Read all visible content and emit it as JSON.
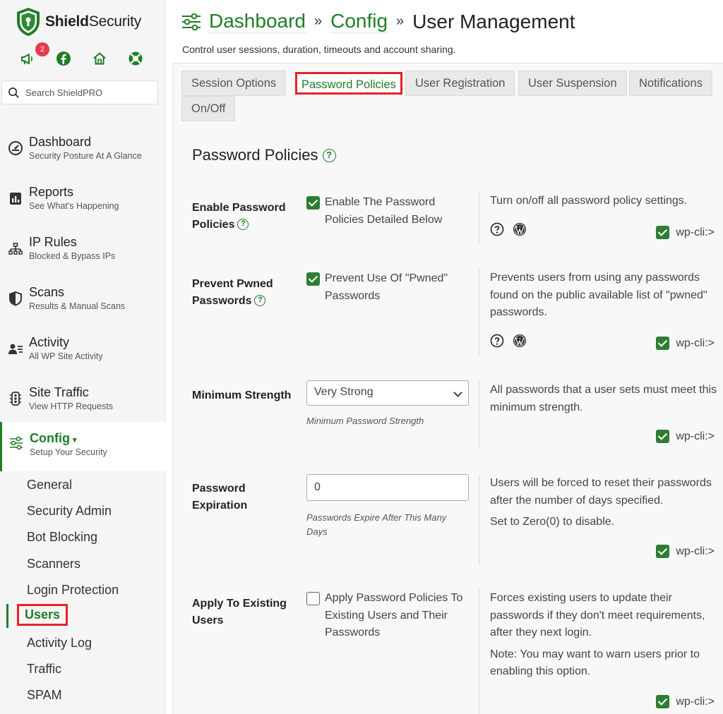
{
  "brand": {
    "name_bold": "Shield",
    "name_rest": "Security",
    "brand_color": "#1e7e25",
    "accent_red": "#e8212b"
  },
  "quick_icons": [
    {
      "icon": "megaphone-icon",
      "badge": "2"
    },
    {
      "icon": "facebook-icon"
    },
    {
      "icon": "home-icon"
    },
    {
      "icon": "lifebuoy-icon"
    }
  ],
  "search": {
    "placeholder": "Search ShieldPRO"
  },
  "nav": [
    {
      "icon": "gauge-icon",
      "title": "Dashboard",
      "sub": "Security Posture At A Glance"
    },
    {
      "icon": "reports-icon",
      "title": "Reports",
      "sub": "See What's Happening"
    },
    {
      "icon": "network-icon",
      "title": "IP Rules",
      "sub": "Blocked & Bypass IPs"
    },
    {
      "icon": "shield-half-icon",
      "title": "Scans",
      "sub": "Results & Manual Scans"
    },
    {
      "icon": "user-activity-icon",
      "title": "Activity",
      "sub": "All WP Site Activity"
    },
    {
      "icon": "traffic-icon",
      "title": "Site Traffic",
      "sub": "View HTTP Requests"
    },
    {
      "icon": "sliders-icon",
      "title": "Config",
      "caret": "▾",
      "sub": "Setup Your Security",
      "active": true
    }
  ],
  "config_subnav": [
    "General",
    "Security Admin",
    "Bot Blocking",
    "Scanners",
    "Login Protection",
    "Users",
    "Activity Log",
    "Traffic",
    "SPAM"
  ],
  "config_subnav_active": "Users",
  "breadcrumb": {
    "items": [
      "Dashboard",
      "Config"
    ],
    "separator": "»",
    "current": "User Management"
  },
  "page_description": "Control user sessions, duration, timeouts and account sharing.",
  "tabs": [
    {
      "label": "Session Options"
    },
    {
      "label": "Password Policies",
      "active": true
    },
    {
      "label": "User Registration"
    },
    {
      "label": "User Suspension"
    },
    {
      "label": "Notifications"
    },
    {
      "label": "On/Off"
    }
  ],
  "section_title": "Password Policies",
  "help_glyph": "?",
  "wpcli_label": "wp-cli:>",
  "options": [
    {
      "label": "Enable Password Policies",
      "control": "checkbox",
      "checked": true,
      "control_text": "Enable The Password Policies Detailed Below",
      "description": "Turn on/off all password policy settings.",
      "icons": [
        "help-circle-icon",
        "wordpress-icon"
      ],
      "wpcli_checked": true
    },
    {
      "label": "Prevent Pwned Passwords",
      "control": "checkbox",
      "checked": true,
      "control_text": "Prevent Use Of \"Pwned\" Passwords",
      "description": "Prevents users from using any passwords found on the public available list of \"pwned\" passwords.",
      "icons": [
        "help-circle-icon",
        "wordpress-icon"
      ],
      "wpcli_checked": true
    },
    {
      "label": "Minimum Strength",
      "control": "select",
      "value": "Very Strong",
      "helper": "Minimum Password Strength",
      "description": "All passwords that a user sets must meet this minimum strength.",
      "wpcli_checked": true
    },
    {
      "label": "Password Expiration",
      "control": "text",
      "value": "0",
      "helper": "Passwords Expire After This Many Days",
      "description": "Users will be forced to reset their passwords after the number of days specified.",
      "note": "Set to Zero(0) to disable.",
      "wpcli_checked": true
    },
    {
      "label": "Apply To Existing Users",
      "control": "checkbox",
      "checked": false,
      "control_text": "Apply Password Policies To Existing Users and Their Passwords",
      "description": "Forces existing users to update their passwords if they don't meet requirements, after they next login.",
      "note": "Note: You may want to warn users prior to enabling this option.",
      "wpcli_checked": true
    }
  ]
}
